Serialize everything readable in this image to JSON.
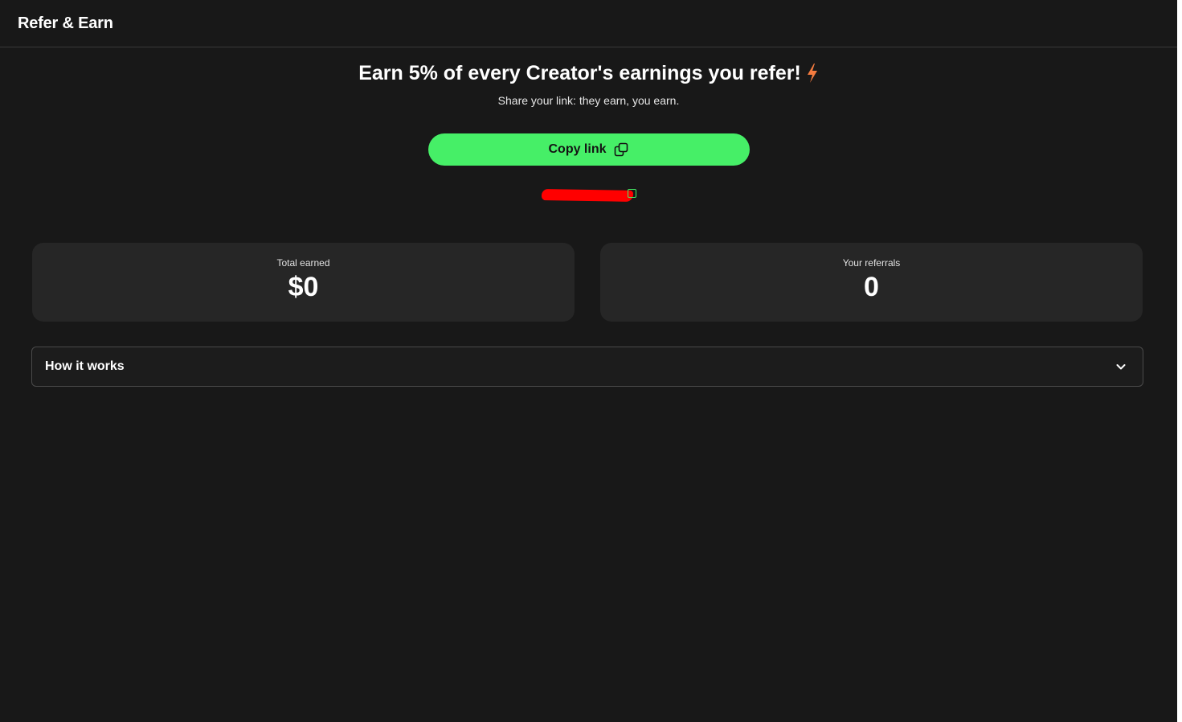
{
  "header": {
    "title": "Refer & Earn"
  },
  "hero": {
    "headline": "Earn 5% of every Creator's earnings you refer!",
    "headline_icon": "lightning-bolt-icon",
    "subtitle": "Share your link: they earn, you earn."
  },
  "copy_button": {
    "label": "Copy link",
    "icon": "copy-icon"
  },
  "referral_link": {
    "state": "redacted"
  },
  "stats": [
    {
      "label": "Total earned",
      "value": "$0"
    },
    {
      "label": "Your referrals",
      "value": "0"
    }
  ],
  "accordion": {
    "label": "How it works",
    "icon": "chevron-down-icon",
    "expanded": false
  },
  "colors": {
    "background": "#181818",
    "card": "#262626",
    "accent_green": "#46ef67",
    "bolt_orange": "#f47b3f",
    "redaction_red": "#ff0000"
  }
}
